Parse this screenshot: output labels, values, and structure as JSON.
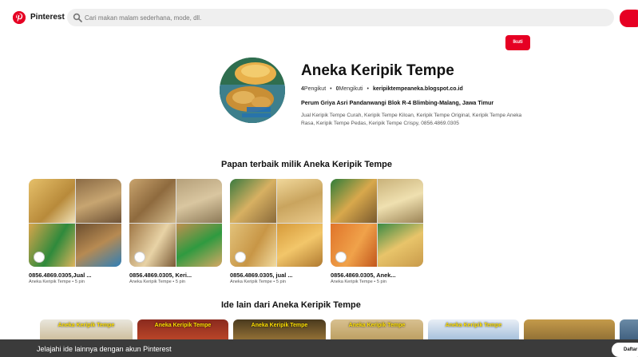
{
  "app": {
    "brand": "Pinterest"
  },
  "search": {
    "placeholder": "Cari makan malam sederhana, mode, dll."
  },
  "profile": {
    "follow_label": "Ikuti",
    "name": "Aneka Keripik Tempe",
    "followers_count": "4",
    "followers_label": "Pengikut",
    "following_count": "0",
    "following_label": "Mengikuti",
    "website": "keripiktempeaneka.blogspot.co.id",
    "address": "Perum Griya Asri Pandanwangi Blok R-4 Blimbing-Malang, Jawa Timur",
    "bio": "Jual Keripik Tempe Curah, Keripik Tempe Kiloan, Keripik Tempe Original, Keripik Tempe Aneka Rasa, Keripik Tempe Pedas, Keripik Tempe Crispy, 0856.4869.0305"
  },
  "boards_section": {
    "title": "Papan terbaik milik Aneka Keripik Tempe",
    "boards": [
      {
        "title": "0856.4869.0305,Jual ...",
        "meta": "Aneka Keripik Tempe • 5 pin"
      },
      {
        "title": "0856.4869.0305, Keri...",
        "meta": "Aneka Keripik Tempe • 5 pin"
      },
      {
        "title": "0856.4869.0305, jual ...",
        "meta": "Aneka Keripik Tempe • 5 pin"
      },
      {
        "title": "0856.4869.0305, Anek...",
        "meta": "Aneka Keripik Tempe • 5 pin"
      }
    ]
  },
  "ideas_section": {
    "title": "Ide lain dari Aneka Keripik Tempe",
    "thumb_labels": [
      "Aneka Keripik Tempe",
      "Aneka Keripik Tempe",
      "Aneka Keripik Tempe",
      "Aneka Keripik Tempe",
      "Aneka Keripik Tempe"
    ]
  },
  "bottom_bar": {
    "text": "Jelajahi ide lainnya dengan akun Pinterest",
    "signup_label": "Daftar"
  },
  "colors": {
    "brand_red": "#e60023",
    "bottom_bar": "#3b3b3b",
    "search_bg": "#efefef"
  },
  "icons": [
    "pinterest-logo-icon",
    "search-icon"
  ]
}
